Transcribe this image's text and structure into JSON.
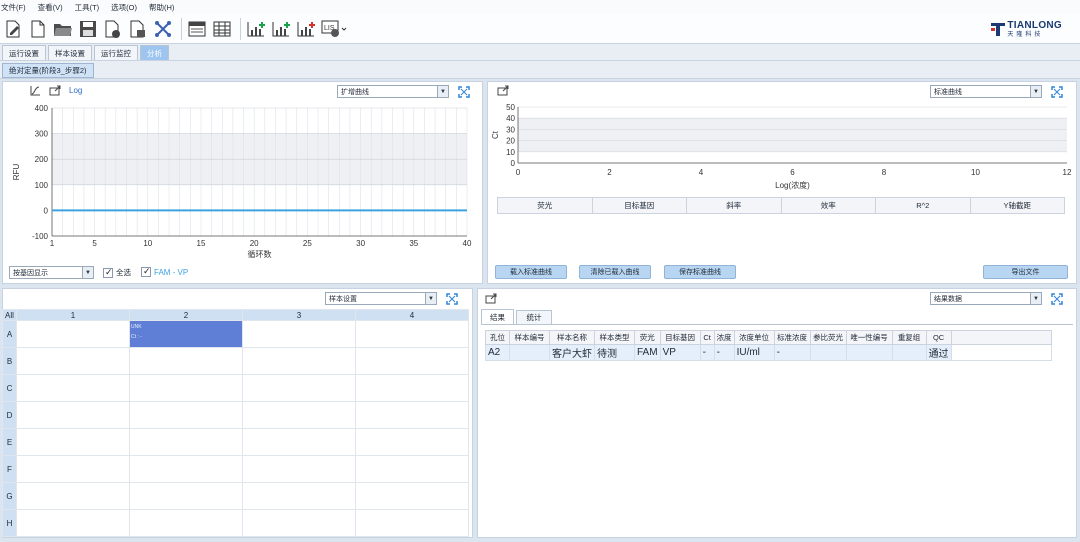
{
  "menu": [
    "文件(F)",
    "查看(V)",
    "工具(T)",
    "选项(O)",
    "帮助(H)"
  ],
  "toolbar": {
    "icons": [
      "new-file-icon",
      "blank-doc-icon",
      "open-folder-icon",
      "save-icon",
      "save-as-icon",
      "print-icon",
      "network-icon",
      "plate-view-icon",
      "table-view-icon",
      "chart-add-icon",
      "chart-add2-icon",
      "chart-add3-icon",
      "lis-icon"
    ]
  },
  "logo": {
    "name": "TIANLONG",
    "sub": "天隆科技"
  },
  "tabs": [
    "运行设置",
    "样本设置",
    "运行监控",
    "分析"
  ],
  "active_tab": "分析",
  "subtab": "绝对定量(阶段3_步骤2)",
  "amp_panel": {
    "log_label": "Log",
    "curve_select": "扩增曲线",
    "chart_data": {
      "type": "line",
      "xlabel": "循环数",
      "ylabel": "RFU",
      "xlim": [
        1,
        40
      ],
      "ylim": [
        -100,
        400
      ],
      "xticks": [
        1,
        5,
        10,
        15,
        20,
        25,
        30,
        35,
        40
      ],
      "yticks": [
        -100,
        0,
        100,
        200,
        300,
        400
      ],
      "series": [
        {
          "color": "#3ea2e0",
          "x": [
            1,
            40
          ],
          "y": [
            0,
            0
          ]
        }
      ]
    },
    "group_select": "按基因显示",
    "select_all": "全选",
    "channel": "FAM - VP"
  },
  "std_panel": {
    "select": "标准曲线",
    "chart_data": {
      "type": "scatter",
      "xlabel": "Log(浓度)",
      "ylabel": "Ct",
      "xlim": [
        0,
        12
      ],
      "ylim": [
        0,
        50
      ],
      "xticks": [
        0,
        2,
        4,
        6,
        8,
        10,
        12
      ],
      "yticks": [
        0,
        10,
        20,
        30,
        40,
        50
      ]
    },
    "columns": [
      "荧光",
      "目标基因",
      "斜率",
      "效率",
      "R^2",
      "Y轴截距"
    ],
    "buttons": {
      "load": "载入标准曲线",
      "clear": "清除已载入曲线",
      "save": "保存标准曲线",
      "export": "导出文件"
    }
  },
  "plate_panel": {
    "select": "样本设置",
    "corner": "All",
    "columns": [
      "1",
      "2",
      "3",
      "4"
    ],
    "rows": [
      "A",
      "B",
      "C",
      "D",
      "E",
      "F",
      "G",
      "H"
    ],
    "well_A2": {
      "type": "UNK",
      "ct": "Ct : -"
    }
  },
  "result_panel": {
    "select": "结果数据",
    "tabs": [
      "结果",
      "统计"
    ],
    "columns": [
      "孔位",
      "样本编号",
      "样本名称",
      "样本类型",
      "荧光",
      "目标基因",
      "Ct",
      "浓度",
      "浓度单位",
      "标准浓度",
      "参比荧光",
      "唯一性编号",
      "重复组",
      "QC"
    ],
    "rows": [
      [
        "A2",
        "",
        "客户大虾",
        "待测",
        "FAM",
        "VP",
        "-",
        "-",
        "IU/ml",
        "-",
        "",
        "",
        "",
        "通过"
      ]
    ]
  }
}
